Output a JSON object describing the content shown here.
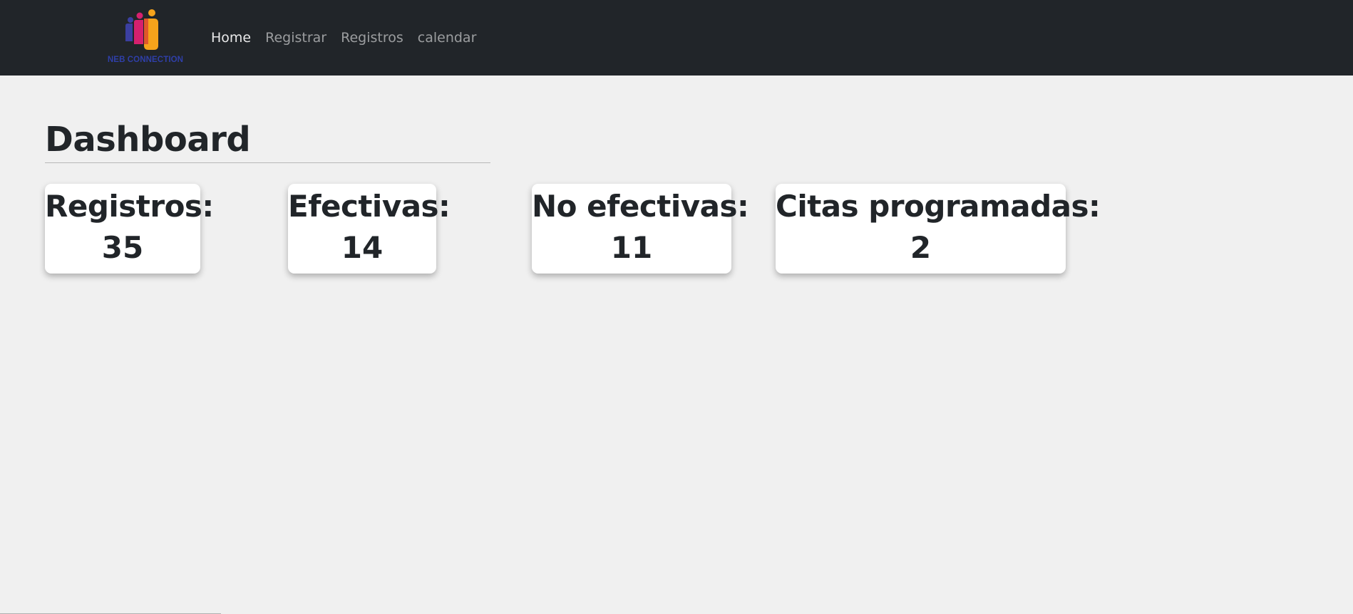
{
  "brand": {
    "name": "NEB CONNECTION",
    "logo_icon": "people-logo-icon"
  },
  "nav": {
    "items": [
      {
        "label": "Home",
        "active": true
      },
      {
        "label": "Registrar",
        "active": false
      },
      {
        "label": "Registros",
        "active": false
      },
      {
        "label": "calendar",
        "active": false
      }
    ]
  },
  "page": {
    "title": "Dashboard"
  },
  "stats": [
    {
      "label": "Registros:",
      "value": "35"
    },
    {
      "label": "Efectivas:",
      "value": "14"
    },
    {
      "label": "No efectivas:",
      "value": "11"
    },
    {
      "label": "Citas programadas:",
      "value": "2"
    }
  ],
  "colors": {
    "navbar_bg": "#212529",
    "page_bg": "#f0f0f0",
    "brand_text": "#2f3fa8",
    "logo_purple": "#3b3fa0",
    "logo_magenta": "#d6206e",
    "logo_orange": "#f6a31b"
  }
}
